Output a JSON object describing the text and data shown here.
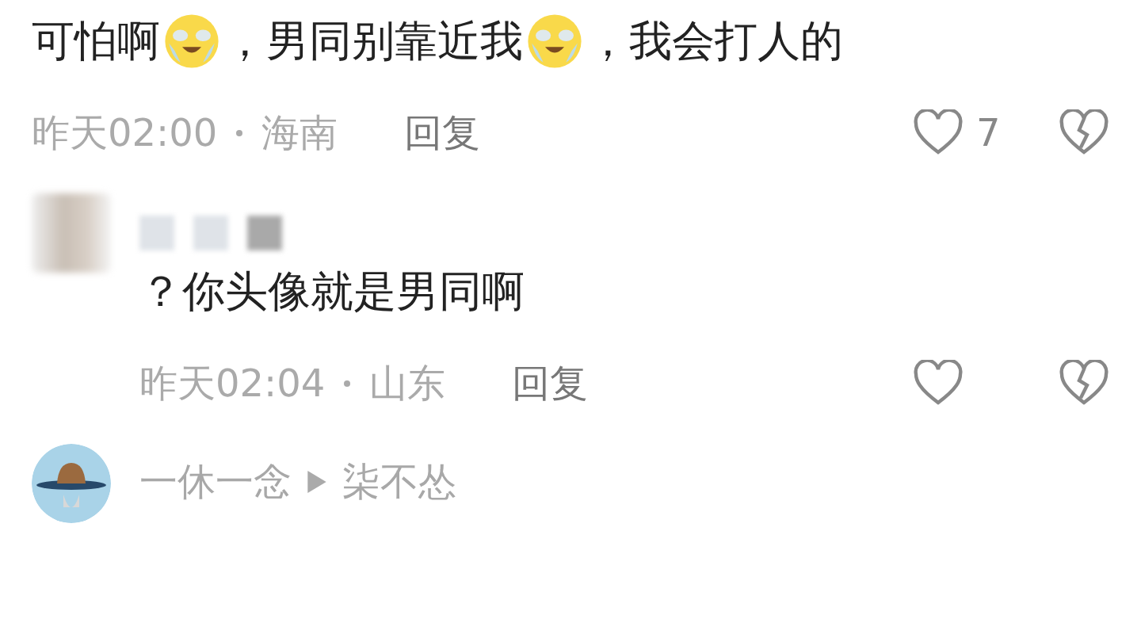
{
  "comments": [
    {
      "kind": "plain",
      "segments": [
        {
          "kind": "text",
          "text": "可怕啊"
        },
        {
          "kind": "emoji"
        },
        {
          "kind": "text",
          "text": "，男同别靠近我"
        },
        {
          "kind": "emoji"
        },
        {
          "kind": "text",
          "text": "，我会打人的"
        }
      ],
      "time": "昨天02:00",
      "location": "海南",
      "reply": "回复",
      "likes": "7"
    },
    {
      "kind": "hidden",
      "segments": [
        {
          "kind": "text",
          "text": "？你头像就是男同啊"
        }
      ],
      "time": "昨天02:04",
      "location": "山东",
      "reply": "回复"
    },
    {
      "kind": "named",
      "author": "一休一念",
      "reply_to": "柒不怂"
    }
  ]
}
